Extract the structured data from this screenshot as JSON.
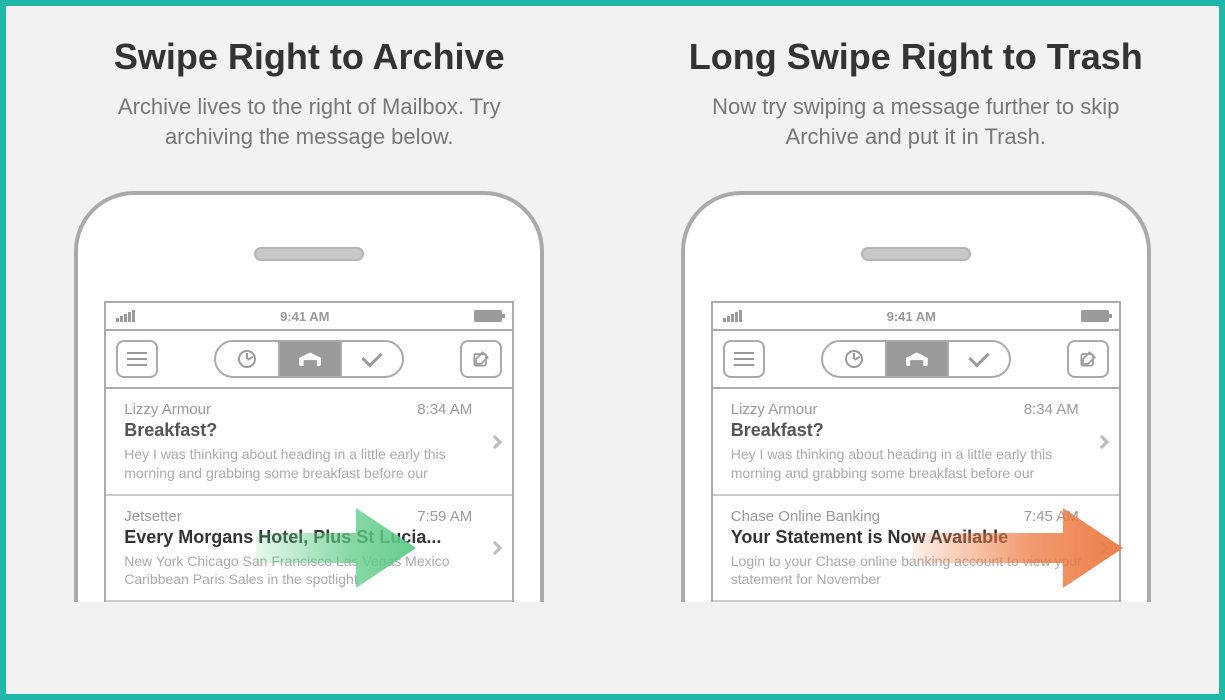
{
  "panels": [
    {
      "title": "Swipe Right to Archive",
      "subtitle": "Archive lives to the right of Mailbox. Try archiving the message below.",
      "statusbar_time": "9:41 AM",
      "messages": [
        {
          "from": "Lizzy Armour",
          "time": "8:34 AM",
          "subject": "Breakfast?",
          "preview": "Hey I was thinking about heading in a little early this morning and grabbing some breakfast before our"
        },
        {
          "from": "Jetsetter",
          "time": "7:59 AM",
          "subject": "Every Morgans Hotel, Plus St Lucia...",
          "preview": "New York Chicago San Francisco Las Vegas Mexico Caribbean Paris Sales in the spotlight"
        }
      ],
      "arrow_color": "#5ecb87"
    },
    {
      "title": "Long Swipe Right to Trash",
      "subtitle": "Now try swiping a message further to skip Archive and put it in Trash.",
      "statusbar_time": "9:41 AM",
      "messages": [
        {
          "from": "Lizzy Armour",
          "time": "8:34 AM",
          "subject": "Breakfast?",
          "preview": "Hey I was thinking about heading in a little early this morning and grabbing some breakfast before our"
        },
        {
          "from": "Chase Online Banking",
          "time": "7:45 AM",
          "subject": "Your Statement is Now Available",
          "preview": "Login to your Chase online banking account to view your statement for November"
        }
      ],
      "arrow_color": "#ed7a42"
    }
  ]
}
